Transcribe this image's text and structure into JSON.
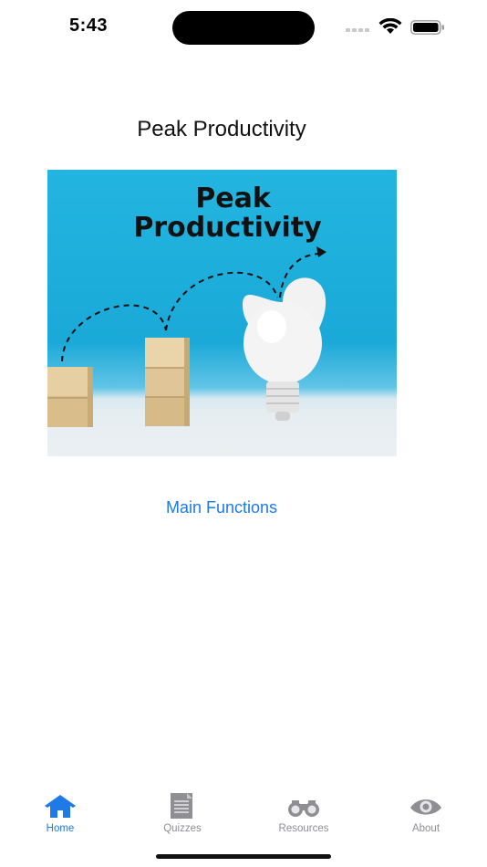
{
  "status_bar": {
    "time": "5:43"
  },
  "page": {
    "title": "Peak Productivity"
  },
  "hero_image": {
    "line1": "Peak",
    "line2": "Productivity"
  },
  "main_link": "Main Functions",
  "tabs": [
    {
      "label": "Home",
      "icon": "house-icon",
      "active": true
    },
    {
      "label": "Quizzes",
      "icon": "document-icon",
      "active": false
    },
    {
      "label": "Resources",
      "icon": "binoculars-icon",
      "active": false
    },
    {
      "label": "About",
      "icon": "eye-icon",
      "active": false
    }
  ],
  "colors": {
    "accent": "#1f7ae8",
    "inactive": "#8e8e93",
    "hero_bg": "#1aa9d8"
  }
}
